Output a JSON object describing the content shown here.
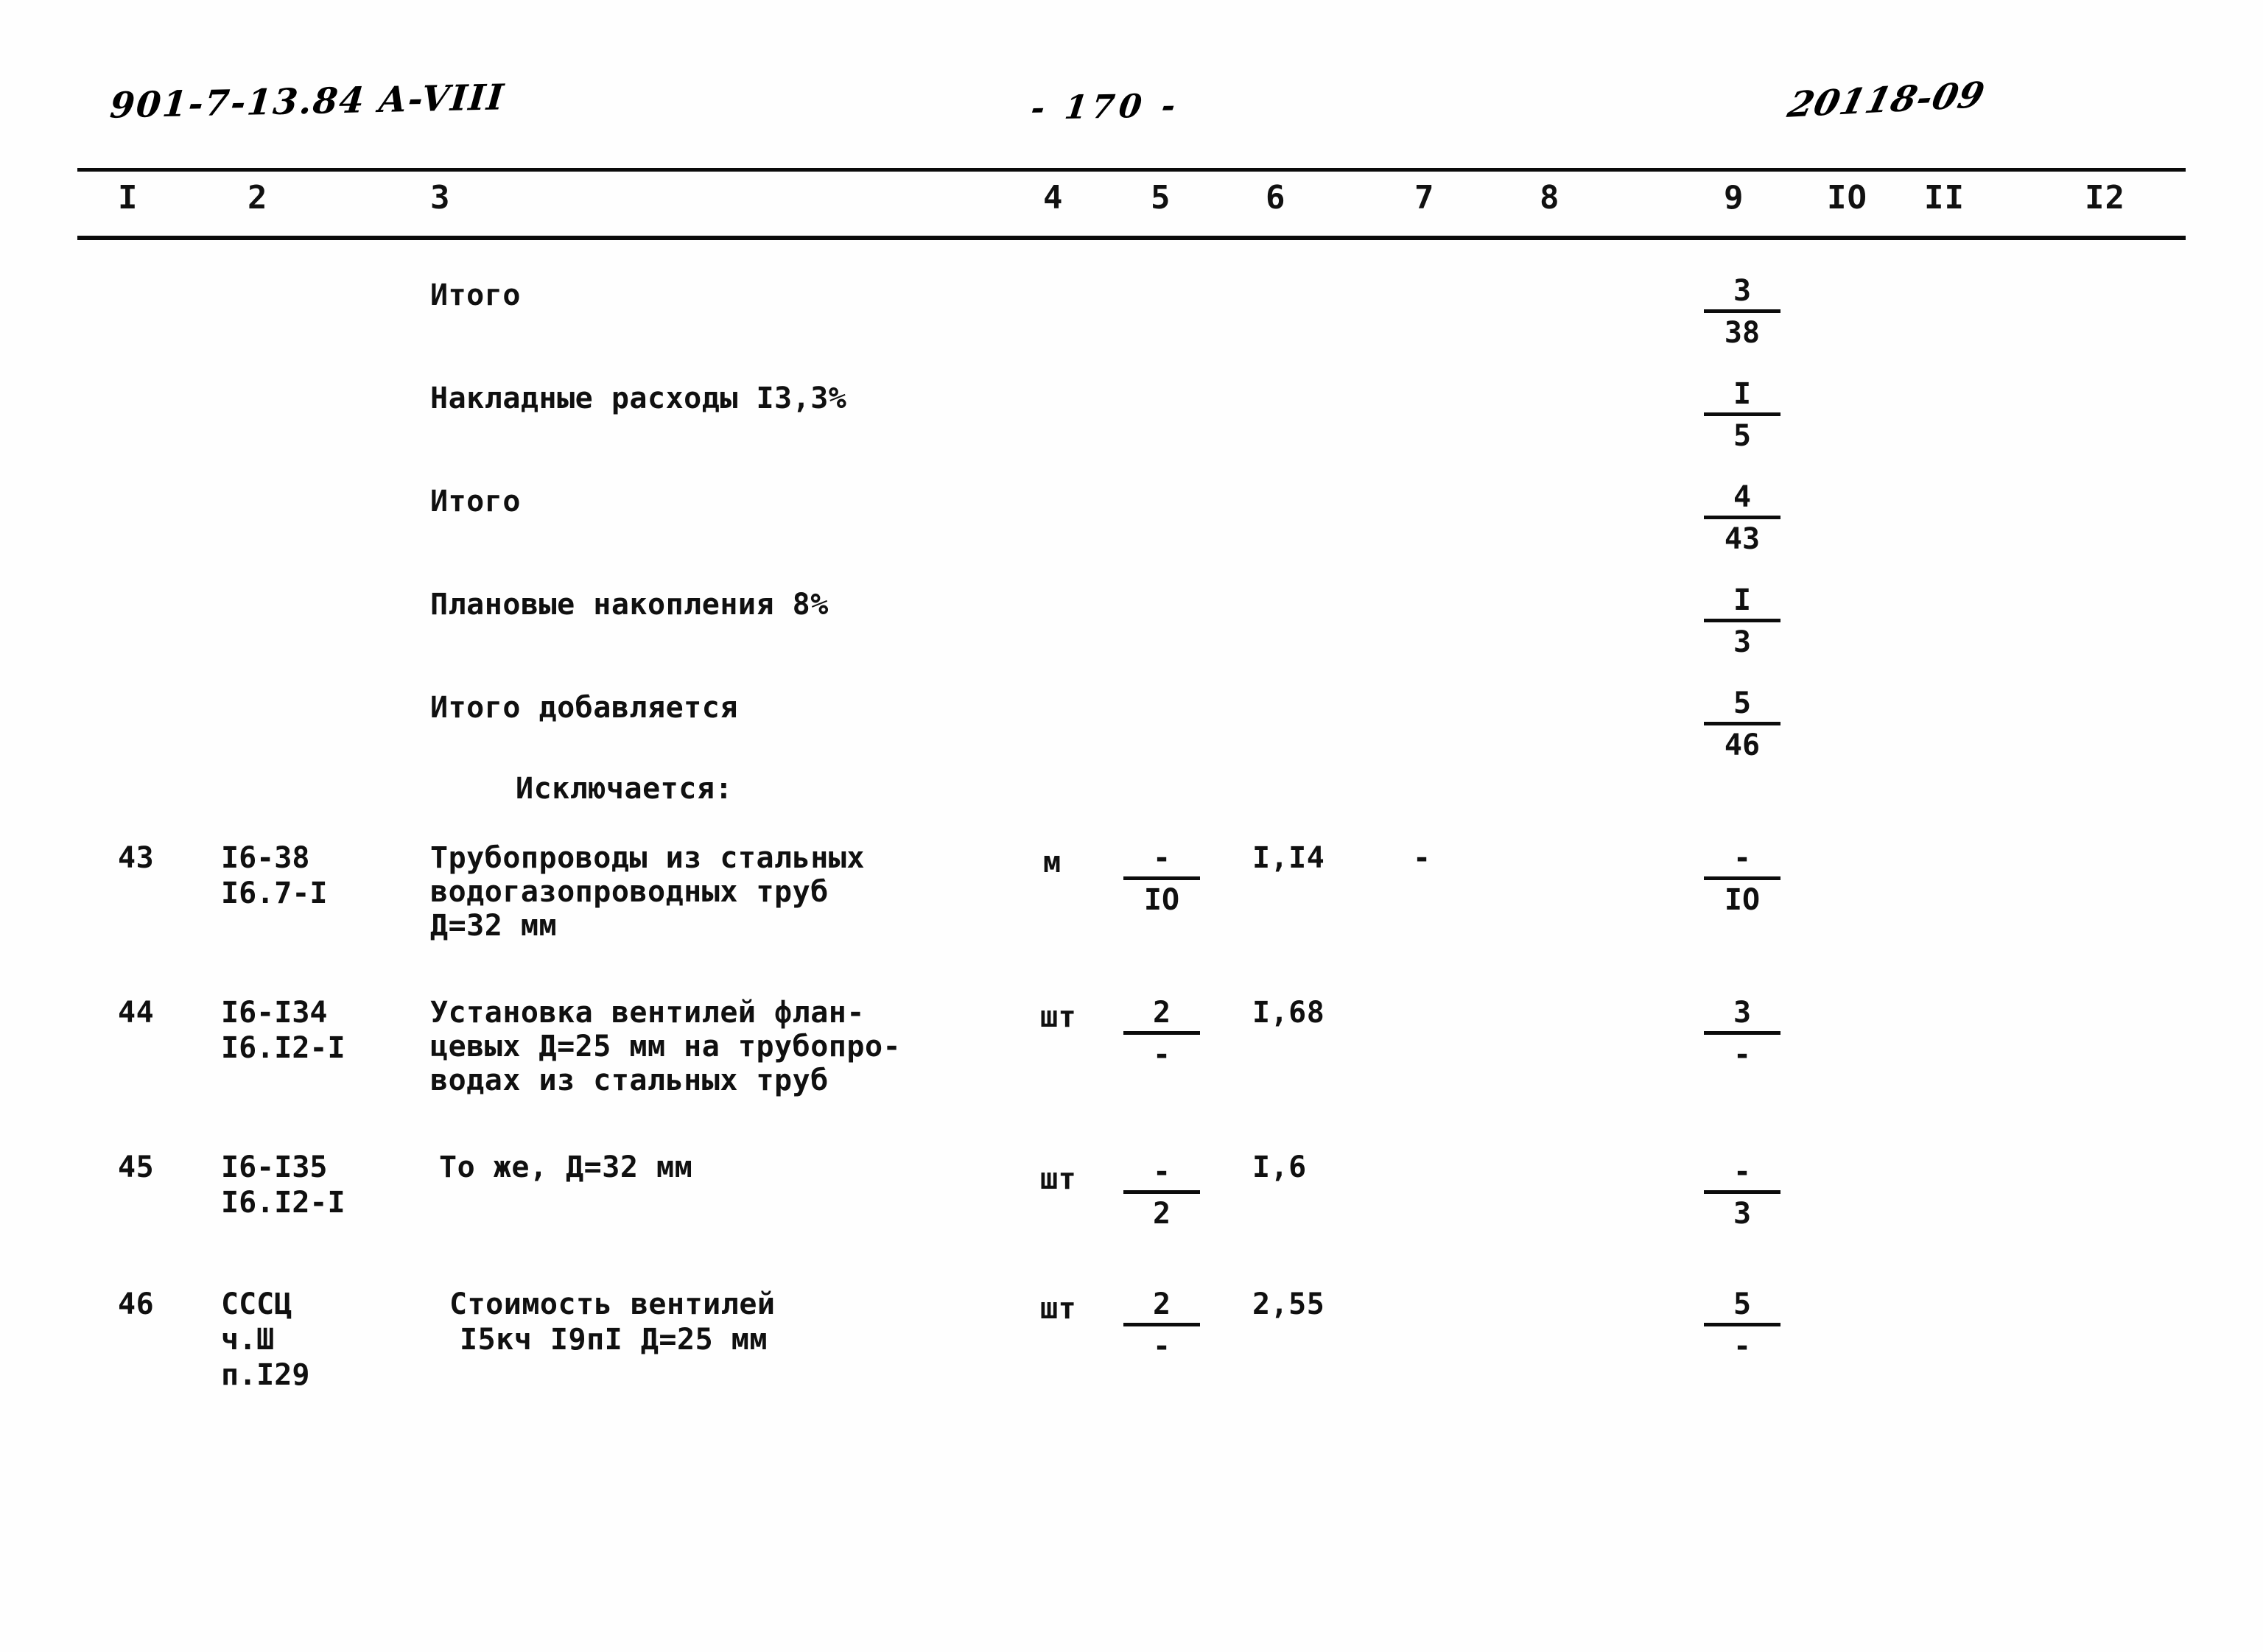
{
  "header": {
    "doc_code": "901-7-13.84  A-VIII",
    "page_number": "- 170 -",
    "archive_code": "20118-09"
  },
  "table": {
    "column_headers": [
      "I",
      "2",
      "3",
      "4",
      "5",
      "6",
      "7",
      "8",
      "9",
      "IO",
      "II",
      "I2"
    ],
    "summary_rows": [
      {
        "label": "Итого",
        "col9_num": "3",
        "col9_den": "38"
      },
      {
        "label": "Накладные расходы I3,3%",
        "col9_num": "I",
        "col9_den": "5"
      },
      {
        "label": "Итого",
        "col9_num": "4",
        "col9_den": "43"
      },
      {
        "label": "Плановые накопления 8%",
        "col9_num": "I",
        "col9_den": "3"
      },
      {
        "label": "Итого добавляется",
        "col9_num": "5",
        "col9_den": "46"
      }
    ],
    "section_label": "Исключается:",
    "item_rows": [
      {
        "no": "43",
        "code_line1": "I6-38",
        "code_line2": "I6.7-I",
        "desc_line1": "Трубопроводы из стальных",
        "desc_line2": "водогазопроводных труб",
        "desc_line3": "Д=32 мм",
        "unit": "м",
        "col5_num": "-",
        "col5_den": "IO",
        "col6": "I,I4",
        "col7": "-",
        "col9_num": "-",
        "col9_den": "IO"
      },
      {
        "no": "44",
        "code_line1": "I6-I34",
        "code_line2": "I6.I2-I",
        "desc_line1": "Установка вентилей флан-",
        "desc_line2": "цевых Д=25 мм на трубопро-",
        "desc_line3": "водах из стальных труб",
        "unit": "шт",
        "col5_num": "2",
        "col5_den": "-",
        "col6": "I,68",
        "col7": "",
        "col9_num": "3",
        "col9_den": "-"
      },
      {
        "no": "45",
        "code_line1": "I6-I35",
        "code_line2": "I6.I2-I",
        "desc_line1": "То же, Д=32 мм",
        "desc_line2": "",
        "desc_line3": "",
        "unit": "шт",
        "col5_num": "-",
        "col5_den": "2",
        "col6": "I,6",
        "col7": "",
        "col9_num": "-",
        "col9_den": "3"
      },
      {
        "no": "46",
        "code_line1": "СССЦ",
        "code_line2": "ч.Ш",
        "code_line3": "п.I29",
        "desc_line1": "Стоимость вентилей",
        "desc_line2": "I5кч I9пI Д=25 мм",
        "desc_line3": "",
        "unit": "шт",
        "col5_num": "2",
        "col5_den": "-",
        "col6": "2,55",
        "col7": "",
        "col9_num": "5",
        "col9_den": "-"
      }
    ]
  }
}
